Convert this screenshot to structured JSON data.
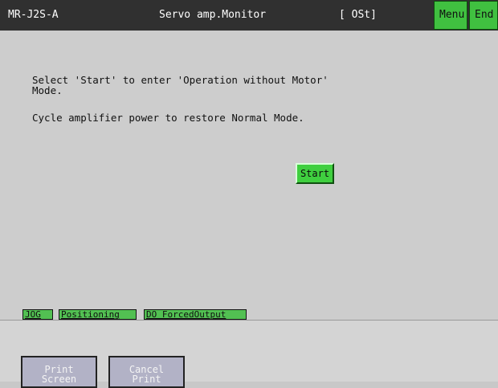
{
  "header": {
    "model": "MR-J2S-A",
    "title": "Servo amp.Monitor",
    "status": "[ OSt]",
    "menu_label": "Menu",
    "end_label": "End"
  },
  "main": {
    "message_1": "Select 'Start' to enter 'Operation without Motor'\nMode.",
    "message_2": "Cycle amplifier power to restore Normal Mode.",
    "start_label": "Start"
  },
  "tabs": [
    {
      "label": "JOG"
    },
    {
      "label": "Positioning"
    },
    {
      "label": "DO ForcedOutput"
    }
  ],
  "footer": {
    "print_screen_line1": "Print",
    "print_screen_line2": "Screen",
    "cancel_print_line1": "Cancel",
    "cancel_print_line2": "Print"
  },
  "colors": {
    "title_bar": "#303030",
    "button_green": "#40c040",
    "background": "#cdcdcd",
    "print_button": "#b2b2c6"
  }
}
